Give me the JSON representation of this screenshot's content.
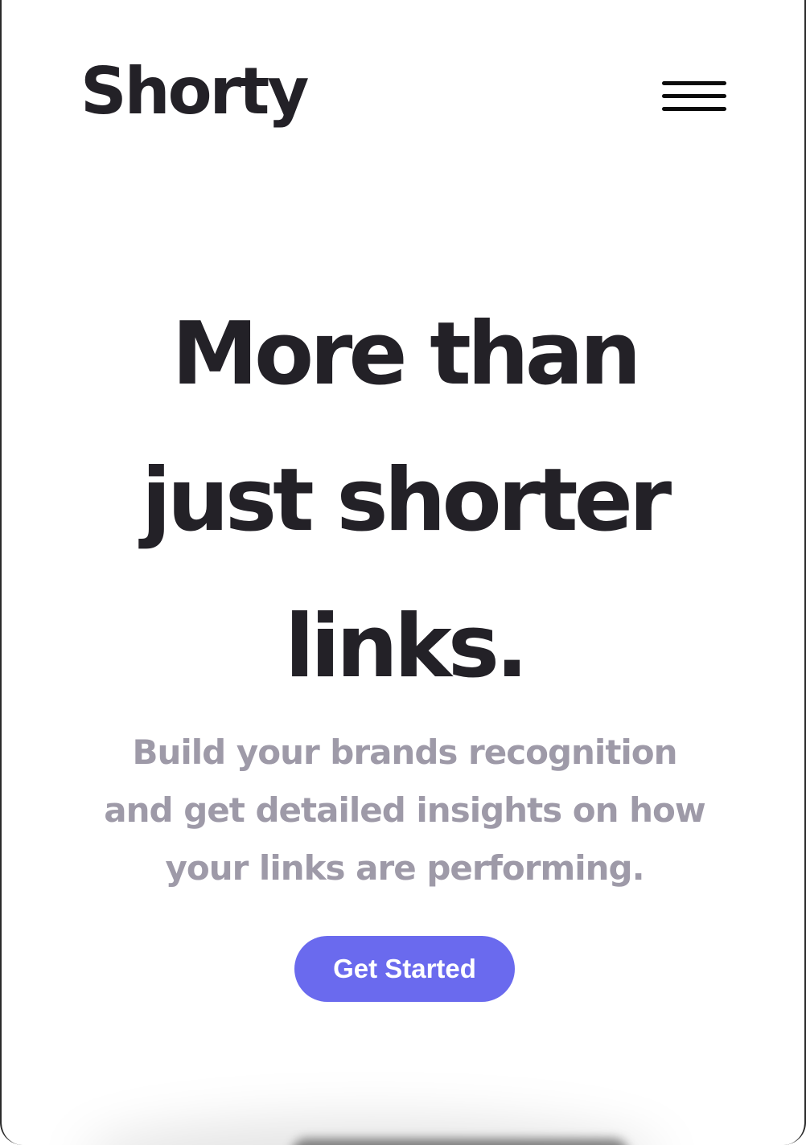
{
  "header": {
    "logo_text": "Shorty",
    "menu_icon": "hamburger-menu-icon"
  },
  "hero": {
    "title_lines": [
      "More than",
      "just shorter",
      "links."
    ],
    "subtitle_lines": [
      "Build your brands recognition",
      "and get detailed insights on how",
      "your links are performing."
    ],
    "cta_label": "Get Started"
  },
  "colors": {
    "text_dark": "#232127",
    "text_muted": "#9e9aa8",
    "accent": "#6a6aee",
    "background": "#ffffff"
  }
}
